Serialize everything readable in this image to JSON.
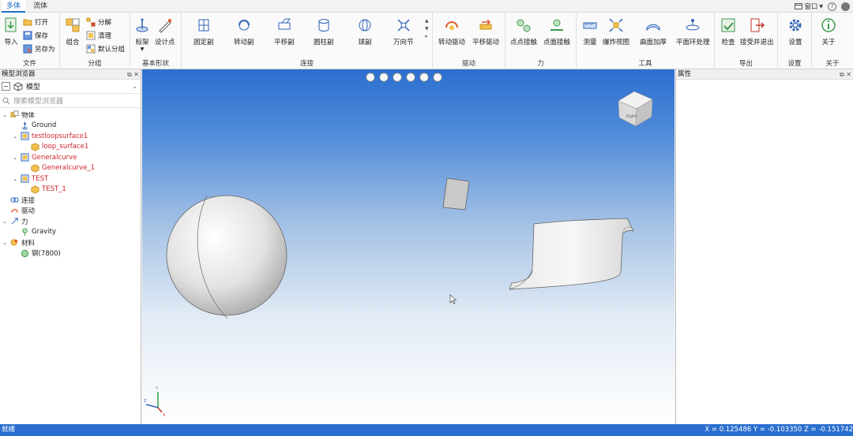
{
  "tabs": [
    "多体",
    "流体"
  ],
  "window_menu": {
    "label": "窗口",
    "help": "?"
  },
  "ribbon": {
    "file": {
      "label": "文件",
      "import": "导入",
      "open": "打开",
      "save": "保存",
      "save_as": "另存为"
    },
    "grouping": {
      "label": "分组",
      "combine": "组合",
      "split": "分解",
      "clean": "清理",
      "default_group": "默认分组"
    },
    "basic_shapes": {
      "label": "基本形状",
      "frame": "标架",
      "design_point": "设计点"
    },
    "connection": {
      "label": "连接",
      "fixed": "固定副",
      "revolute": "转动副",
      "translational": "平移副",
      "cylindrical": "圆柱副",
      "spherical": "球副",
      "universal": "万向节"
    },
    "drive": {
      "label": "驱动",
      "rot_drive": "转动驱动",
      "trans_drive": "平移驱动"
    },
    "force": {
      "label": "力",
      "point_point": "点点接触",
      "point_surface": "点面接触"
    },
    "tools": {
      "label": "工具",
      "measure": "测量",
      "explode": "爆炸视图",
      "thicken": "曲面加厚",
      "planar_ring": "平面环处理"
    },
    "export": {
      "label": "导出",
      "check": "检查",
      "accept_exit": "接受并退出"
    },
    "settings": {
      "label": "设置",
      "settings": "设置"
    },
    "about": {
      "label": "关于",
      "about": "关于"
    }
  },
  "left_panel": {
    "title": "模型浏览器",
    "model_select": "模型",
    "search_placeholder": "搜索模型浏览器",
    "tree": [
      {
        "label": "物体",
        "level": 0,
        "expanded": true,
        "red": false,
        "icon": "bodies-icon"
      },
      {
        "label": "Ground",
        "level": 1,
        "expanded": null,
        "red": false,
        "icon": "ground-icon"
      },
      {
        "label": "testloopsurface1",
        "level": 1,
        "expanded": true,
        "red": true,
        "icon": "part-icon"
      },
      {
        "label": "loop_surface1",
        "level": 2,
        "expanded": null,
        "red": true,
        "icon": "cube-icon"
      },
      {
        "label": "Generalcurve",
        "level": 1,
        "expanded": true,
        "red": true,
        "icon": "part-icon"
      },
      {
        "label": "Generalcurve_1",
        "level": 2,
        "expanded": null,
        "red": true,
        "icon": "cube-icon"
      },
      {
        "label": "TEST",
        "level": 1,
        "expanded": true,
        "red": true,
        "icon": "part-icon"
      },
      {
        "label": "TEST_1",
        "level": 2,
        "expanded": null,
        "red": true,
        "icon": "cube-icon"
      },
      {
        "label": "连接",
        "level": 0,
        "expanded": null,
        "red": false,
        "icon": "joint-icon"
      },
      {
        "label": "驱动",
        "level": 0,
        "expanded": null,
        "red": false,
        "icon": "drive-icon"
      },
      {
        "label": "力",
        "level": 0,
        "expanded": true,
        "red": false,
        "icon": "force-icon"
      },
      {
        "label": "Gravity",
        "level": 1,
        "expanded": null,
        "red": false,
        "icon": "gravity-icon"
      },
      {
        "label": "材料",
        "level": 0,
        "expanded": true,
        "red": false,
        "icon": "material-icon"
      },
      {
        "label": "钢(7800)",
        "level": 1,
        "expanded": null,
        "red": false,
        "icon": "steel-icon"
      }
    ]
  },
  "viewport": {
    "view_cube_face": "Right",
    "triad": {
      "x": "X",
      "y": "Y",
      "z": "Z"
    }
  },
  "right_panel": {
    "title": "属性"
  },
  "status": {
    "text": "就绪",
    "coords": "X = 0.125486  Y = -0.103350  Z = -0.151742"
  }
}
